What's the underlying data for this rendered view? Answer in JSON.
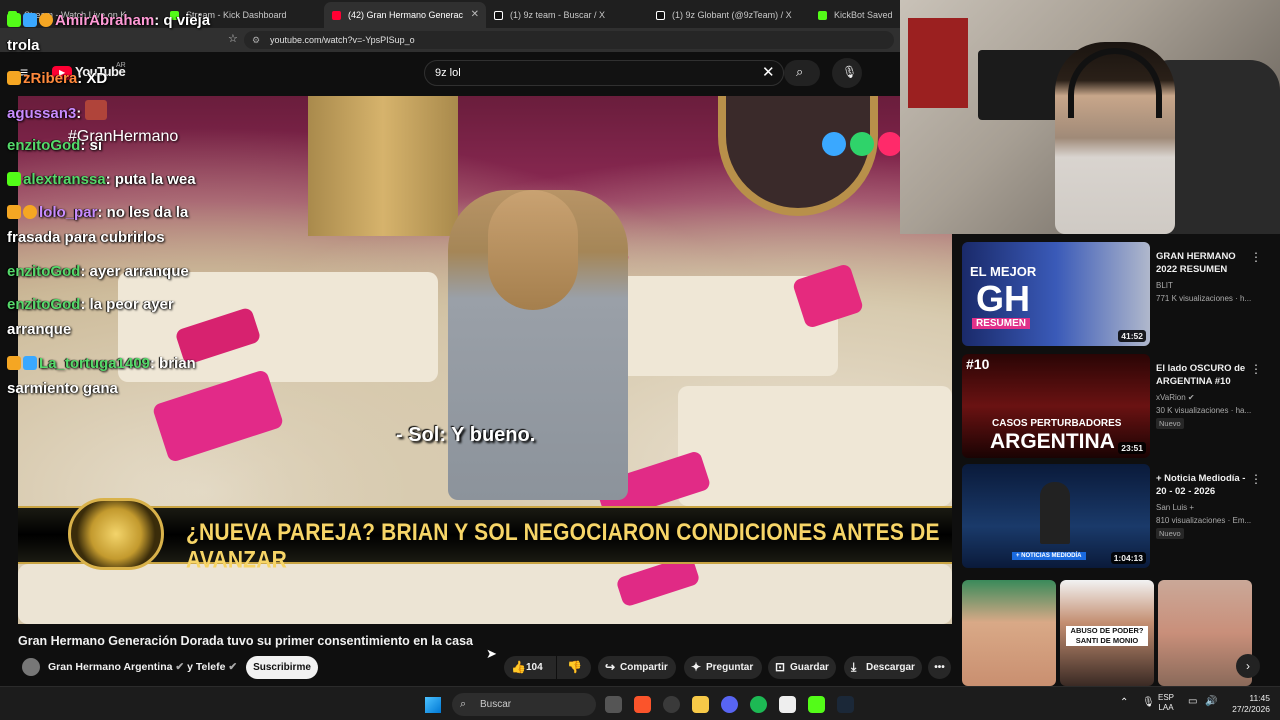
{
  "browser": {
    "tabs": [
      {
        "label": "Stream - Watch Live on K",
        "color": "#53fc18",
        "active": false
      },
      {
        "label": "Stream - Kick Dashboard",
        "color": "#53fc18",
        "active": false
      },
      {
        "label": "(42) Gran Hermano Generac",
        "color": "#ff0033",
        "active": true
      },
      {
        "label": "(1) 9z team - Buscar / X",
        "color": "#ffffff",
        "active": false
      },
      {
        "label": "(1) 9z Globant (@9zTeam) / X",
        "color": "#ffffff",
        "active": false
      },
      {
        "label": "KickBot Saved Wi",
        "color": "#53fc18",
        "active": false
      }
    ],
    "url": "youtube.com/watch?v=-YpsPISup_o"
  },
  "youtube": {
    "logo_text": "YouTube",
    "region": "AR",
    "search_value": "9z lol"
  },
  "chat": [
    {
      "user": "AmirAbraham",
      "message": "q vieja",
      "cont": "trola",
      "user_color": "#ff9ad6"
    },
    {
      "user": "zRibera",
      "message": "XD",
      "cont": "",
      "user_color": "#ff8a3d"
    },
    {
      "user": "agussan3",
      "message": "",
      "cont": "",
      "user_color": "#c88cff"
    },
    {
      "user": "enzitoGod",
      "message": "si",
      "cont": "",
      "user_color": "#55d96a"
    },
    {
      "user": "alextranssa",
      "message": "puta la wea",
      "cont": "",
      "user_color": "#55d96a"
    },
    {
      "user": "lolo_par",
      "message": "no les da la",
      "cont": "frasada para cubrirlos",
      "user_color": "#c88cff"
    },
    {
      "user": "enzitoGod",
      "message": "ayer arranque",
      "cont": "",
      "user_color": "#55d96a"
    },
    {
      "user": "enzitoGod",
      "message": "la peor ayer",
      "cont": "arranque",
      "user_color": "#55d96a"
    },
    {
      "user": "La_tortuga1409",
      "message": "brian",
      "cont": "sarmiento gana",
      "user_color": "#55d96a"
    }
  ],
  "video": {
    "hashtag": "#GranHermano",
    "subtitle": "- Sol: Y bueno.",
    "lower_third": "¿NUEVA PAREJA? BRIAN Y SOL NEGOCIARON CONDICIONES ANTES DE AVANZAR",
    "title": "Gran Hermano Generación Dorada tuvo su primer consentimiento en la casa",
    "channel": "Gran Hermano Argentina",
    "channel_and": "y Telefe",
    "subscribe_label": "Suscribirme",
    "likes": "104",
    "share_label": "Compartir",
    "ask_label": "Preguntar",
    "save_label": "Guardar",
    "download_label": "Descargar"
  },
  "recommendations": [
    {
      "title": "GRAN HERMANO 2022 RESUMEN",
      "channel": "BLIT",
      "meta": "771 K visualizaciones · h...",
      "duration": "41:52",
      "thumb_text1": "EL MEJOR",
      "thumb_text2": "GH",
      "thumb_text3": "RESUMEN",
      "new": ""
    },
    {
      "title": "El lado OSCURO de ARGENTINA #10",
      "channel": "xVaRion",
      "meta": "30 K visualizaciones · ha...",
      "duration": "23:51",
      "thumb_text1": "#10",
      "thumb_text2": "CASOS PERTURBADORES",
      "thumb_text3": "ARGENTINA",
      "new": "Nuevo"
    },
    {
      "title": "+ Noticia Mediodía - 20 - 02 - 2026",
      "channel": "San Luis +",
      "meta": "810 visualizaciones · Em...",
      "duration": "1:04:13",
      "thumb_text1": "+ NOTICIAS MEDIODÍA",
      "thumb_text2": "",
      "thumb_text3": "",
      "new": "Nuevo"
    }
  ],
  "shorts": [
    {
      "caption": ""
    },
    {
      "caption": "ABUSO DE PODER? SANTI DE MONIO"
    },
    {
      "caption": ""
    }
  ],
  "taskbar": {
    "search_placeholder": "Buscar",
    "lang1": "ESP",
    "lang2": "LAA",
    "time": "11:45",
    "date": "27/2/2026"
  }
}
